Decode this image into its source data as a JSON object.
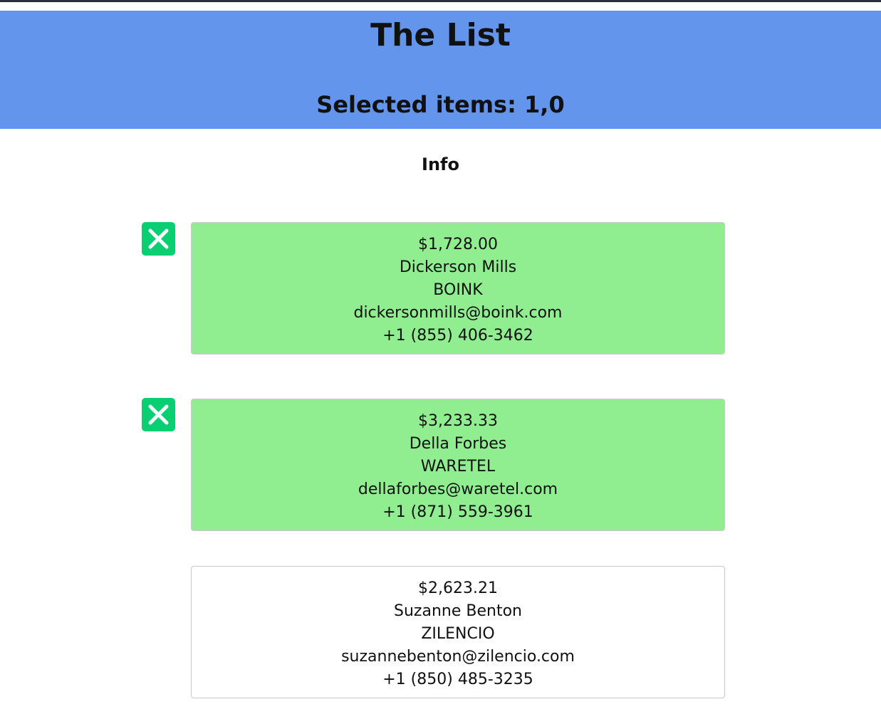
{
  "header": {
    "title": "The List",
    "selected_label": "Selected items: 1,0"
  },
  "info_heading": "Info",
  "colors": {
    "header_bg": "#6495ed",
    "selected_bg": "#90ee90",
    "remove_button": "#09cf73"
  },
  "items": [
    {
      "balance": "$1,728.00",
      "name": "Dickerson Mills",
      "company": "BOINK",
      "email": "dickersonmills@boink.com",
      "phone": "+1 (855) 406-3462",
      "selected": true,
      "remove_icon": "close-icon"
    },
    {
      "balance": "$3,233.33",
      "name": "Della Forbes",
      "company": "WARETEL",
      "email": "dellaforbes@waretel.com",
      "phone": "+1 (871) 559-3961",
      "selected": true,
      "remove_icon": "close-icon"
    },
    {
      "balance": "$2,623.21",
      "name": "Suzanne Benton",
      "company": "ZILENCIO",
      "email": "suzannebenton@zilencio.com",
      "phone": "+1 (850) 485-3235",
      "selected": false
    }
  ]
}
